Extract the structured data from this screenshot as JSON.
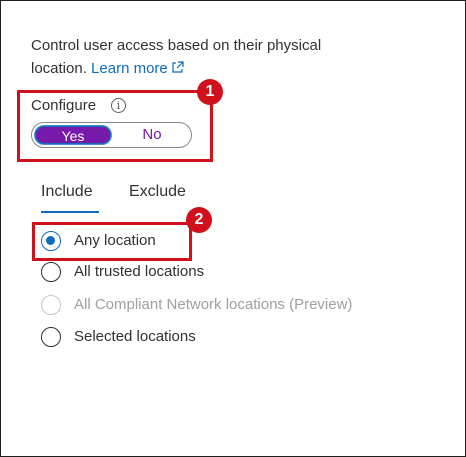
{
  "description": {
    "text": "Control user access based on their physical location.",
    "link": "Learn more"
  },
  "configure": {
    "label": "Configure",
    "info_icon": "info-icon",
    "toggle": {
      "yes": "Yes",
      "no": "No",
      "selected": "Yes"
    }
  },
  "tabs": [
    {
      "label": "Include",
      "active": true
    },
    {
      "label": "Exclude",
      "active": false
    }
  ],
  "locations": [
    {
      "label": "Any location",
      "checked": true,
      "disabled": false
    },
    {
      "label": "All trusted locations",
      "checked": false,
      "disabled": false
    },
    {
      "label": "All Compliant Network locations (Preview)",
      "checked": false,
      "disabled": true
    },
    {
      "label": "Selected locations",
      "checked": false,
      "disabled": false
    }
  ],
  "callouts": [
    "1",
    "2"
  ],
  "colors": {
    "accent": "#0f6cbd",
    "toggle_selected": "#7719aa",
    "callout": "#d0101a"
  }
}
